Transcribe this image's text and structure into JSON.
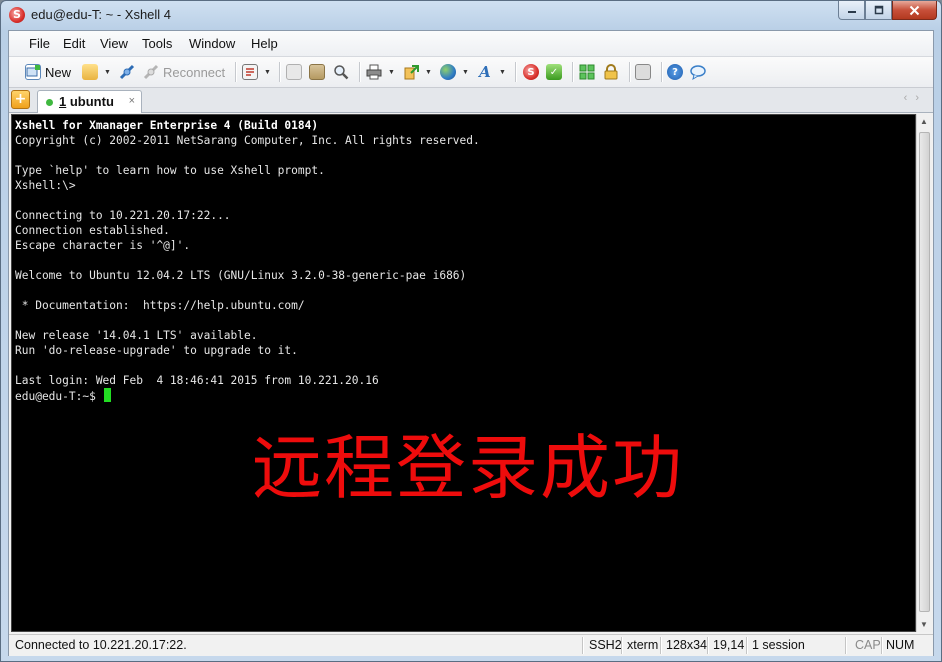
{
  "window": {
    "title": "edu@edu-T: ~ - Xshell 4",
    "icon": "xshell-logo-icon",
    "controls": {
      "minimize": "minimize-icon",
      "maximize": "maximize-icon",
      "close": "close-icon"
    }
  },
  "menu": [
    "File",
    "Edit",
    "View",
    "Tools",
    "Window",
    "Help"
  ],
  "toolbar": {
    "new_label": "New",
    "reconnect_label": "Reconnect",
    "icons": [
      "new-session-icon",
      "open-folder-icon",
      "connect-icon",
      "reconnect-icon",
      "properties-icon",
      "copy-icon",
      "paste-icon",
      "find-icon",
      "print-icon",
      "transfer-icon",
      "globe-icon",
      "font-icon",
      "xftp-icon",
      "xmanager-icon",
      "layout-icon",
      "lock-icon",
      "keyboard-icon",
      "help-icon",
      "chat-icon"
    ]
  },
  "tabs": {
    "new_tab": "add-tab-icon",
    "items": [
      {
        "number": "1",
        "name": " ubuntu",
        "close": "×",
        "status_color": "#3fb83f"
      }
    ],
    "scroll_left": "‹",
    "scroll_right": "›"
  },
  "terminal": {
    "lines": [
      "Xshell for Xmanager Enterprise 4 (Build 0184)",
      "Copyright (c) 2002-2011 NetSarang Computer, Inc. All rights reserved.",
      "",
      "Type `help' to learn how to use Xshell prompt.",
      "Xshell:\\>",
      "",
      "Connecting to 10.221.20.17:22...",
      "Connection established.",
      "Escape character is '^@]'.",
      "",
      "Welcome to Ubuntu 12.04.2 LTS (GNU/Linux 3.2.0-38-generic-pae i686)",
      "",
      " * Documentation:  https://help.ubuntu.com/",
      "",
      "New release '14.04.1 LTS' available.",
      "Run 'do-release-upgrade' to upgrade to it.",
      "",
      "Last login: Wed Feb  4 18:46:41 2015 from 10.221.20.16"
    ],
    "prompt": "edu@edu-T:~$ ",
    "cursor_color": "#22dd22",
    "overlay_text": "远程登录成功",
    "overlay_color": "#ee0c0c"
  },
  "status": {
    "connection": "Connected to 10.221.20.17:22.",
    "protocol": "SSH2",
    "terminal_type": "xterm",
    "size": "128x34",
    "cursor_pos": "19,14",
    "sessions": "1 session",
    "cap": "CAP",
    "num": "NUM"
  }
}
